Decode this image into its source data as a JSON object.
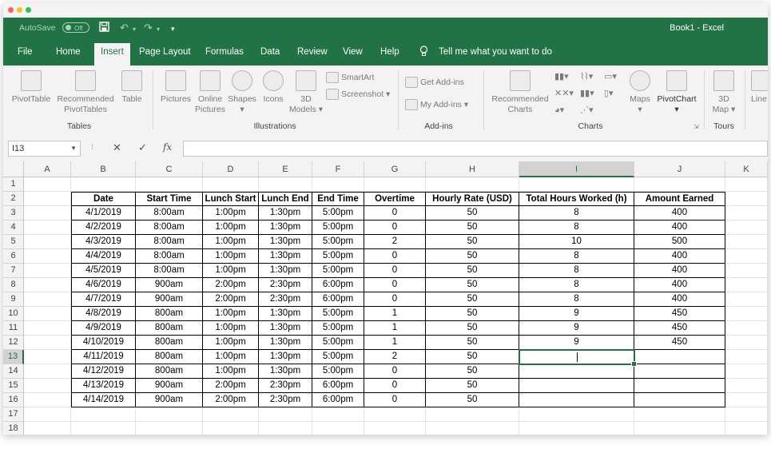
{
  "title_bar": {
    "autosave_label": "AutoSave",
    "autosave_state": "Off",
    "window_title": "Book1 - Excel"
  },
  "tabs": [
    "File",
    "Home",
    "Insert",
    "Page Layout",
    "Formulas",
    "Data",
    "Review",
    "View",
    "Help"
  ],
  "active_tab": "Insert",
  "tell_me": "Tell me what you want to do",
  "ribbon": {
    "pivottable": "PivotTable",
    "recommended_pivottables_1": "Recommended",
    "recommended_pivottables_2": "PivotTables",
    "table": "Table",
    "group_tables": "Tables",
    "pictures": "Pictures",
    "online_pictures_1": "Online",
    "online_pictures_2": "Pictures",
    "shapes": "Shapes",
    "icons": "Icons",
    "models_1": "3D",
    "models_2": "Models",
    "smartart": "SmartArt",
    "screenshot": "Screenshot",
    "group_illustrations": "Illustrations",
    "get_addins": "Get Add-ins",
    "my_addins": "My Add-ins",
    "group_addins": "Add-ins",
    "recommended_charts_1": "Recommended",
    "recommended_charts_2": "Charts",
    "maps": "Maps",
    "pivotchart": "PivotChart",
    "group_charts": "Charts",
    "map3d_1": "3D",
    "map3d_2": "Map",
    "group_tours": "Tours",
    "line_partial": "Line"
  },
  "name_box": "I13",
  "columns": [
    "A",
    "B",
    "C",
    "D",
    "E",
    "F",
    "G",
    "H",
    "I",
    "J",
    "K"
  ],
  "rows": [
    "1",
    "2",
    "3",
    "4",
    "5",
    "6",
    "7",
    "8",
    "9",
    "10",
    "11",
    "12",
    "13",
    "14",
    "15",
    "16",
    "17",
    "18"
  ],
  "headers": [
    "Date",
    "Start Time",
    "Lunch Start",
    "Lunch End",
    "End Time",
    "Overtime",
    "Hourly Rate (USD)",
    "Total Hours Worked (h)",
    "Amount Earned"
  ],
  "table": [
    [
      "4/1/2019",
      "8:00am",
      "1:00pm",
      "1:30pm",
      "5:00pm",
      "0",
      "50",
      "8",
      "400"
    ],
    [
      "4/2/2019",
      "8:00am",
      "1:00pm",
      "1:30pm",
      "5:00pm",
      "0",
      "50",
      "8",
      "400"
    ],
    [
      "4/3/2019",
      "8:00am",
      "1:00pm",
      "1:30pm",
      "5:00pm",
      "2",
      "50",
      "10",
      "500"
    ],
    [
      "4/4/2019",
      "8:00am",
      "1:00pm",
      "1:30pm",
      "5:00pm",
      "0",
      "50",
      "8",
      "400"
    ],
    [
      "4/5/2019",
      "8:00am",
      "1:00pm",
      "1:30pm",
      "5:00pm",
      "0",
      "50",
      "8",
      "400"
    ],
    [
      "4/6/2019",
      "900am",
      "2:00pm",
      "2:30pm",
      "6:00pm",
      "0",
      "50",
      "8",
      "400"
    ],
    [
      "4/7/2019",
      "900am",
      "2:00pm",
      "2:30pm",
      "6:00pm",
      "0",
      "50",
      "8",
      "400"
    ],
    [
      "4/8/2019",
      "800am",
      "1:00pm",
      "1:30pm",
      "5:00pm",
      "1",
      "50",
      "9",
      "450"
    ],
    [
      "4/9/2019",
      "800am",
      "1:00pm",
      "1:30pm",
      "5:00pm",
      "1",
      "50",
      "9",
      "450"
    ],
    [
      "4/10/2019",
      "800am",
      "1:00pm",
      "1:30pm",
      "5:00pm",
      "1",
      "50",
      "9",
      "450"
    ],
    [
      "4/11/2019",
      "800am",
      "1:00pm",
      "1:30pm",
      "5:00pm",
      "2",
      "50",
      "",
      ""
    ],
    [
      "4/12/2019",
      "800am",
      "1:00pm",
      "1:30pm",
      "5:00pm",
      "0",
      "50",
      "",
      ""
    ],
    [
      "4/13/2019",
      "900am",
      "2:00pm",
      "2:30pm",
      "6:00pm",
      "0",
      "50",
      "",
      ""
    ],
    [
      "4/14/2019",
      "900am",
      "2:00pm",
      "2:30pm",
      "6:00pm",
      "0",
      "50",
      "",
      ""
    ]
  ],
  "colors": {
    "excel_green": "#217346",
    "mac_red": "#fe5f57",
    "mac_yellow": "#febc2e",
    "mac_green": "#28c840"
  }
}
